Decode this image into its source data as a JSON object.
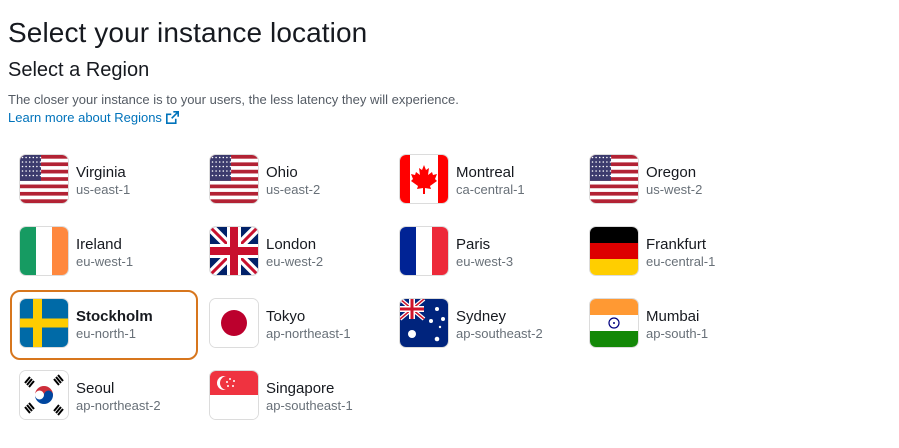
{
  "header": {
    "title": "Select your instance location",
    "subtitle": "Select a Region",
    "description": "The closer your instance is to your users, the less latency they will experience.",
    "learn_more": "Learn more about Regions"
  },
  "colors": {
    "selected_border": "#d7761d",
    "link": "#0073bb"
  },
  "selected_region": "eu-north-1",
  "regions": [
    {
      "name": "Virginia",
      "code": "us-east-1",
      "flag": "usa-flag-icon"
    },
    {
      "name": "Ohio",
      "code": "us-east-2",
      "flag": "usa-flag-icon"
    },
    {
      "name": "Montreal",
      "code": "ca-central-1",
      "flag": "canada-flag-icon"
    },
    {
      "name": "Oregon",
      "code": "us-west-2",
      "flag": "usa-flag-icon"
    },
    {
      "name": "Ireland",
      "code": "eu-west-1",
      "flag": "ireland-flag-icon"
    },
    {
      "name": "London",
      "code": "eu-west-2",
      "flag": "uk-flag-icon"
    },
    {
      "name": "Paris",
      "code": "eu-west-3",
      "flag": "france-flag-icon"
    },
    {
      "name": "Frankfurt",
      "code": "eu-central-1",
      "flag": "germany-flag-icon"
    },
    {
      "name": "Stockholm",
      "code": "eu-north-1",
      "flag": "sweden-flag-icon"
    },
    {
      "name": "Tokyo",
      "code": "ap-northeast-1",
      "flag": "japan-flag-icon"
    },
    {
      "name": "Sydney",
      "code": "ap-southeast-2",
      "flag": "australia-flag-icon"
    },
    {
      "name": "Mumbai",
      "code": "ap-south-1",
      "flag": "india-flag-icon"
    },
    {
      "name": "Seoul",
      "code": "ap-northeast-2",
      "flag": "korea-flag-icon"
    },
    {
      "name": "Singapore",
      "code": "ap-southeast-1",
      "flag": "singapore-flag-icon"
    }
  ]
}
